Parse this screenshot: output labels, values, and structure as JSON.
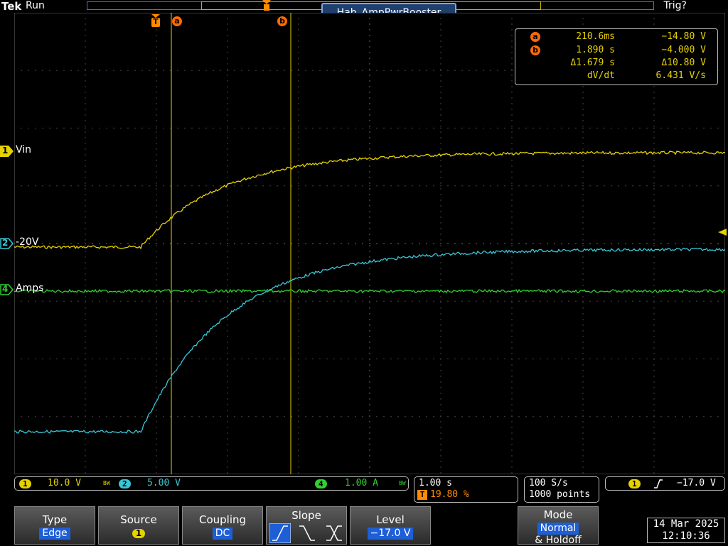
{
  "header": {
    "brand": "Tek",
    "run_state": "Run",
    "trigger_state": "Trig?",
    "title": "Hab_AmpPwrBooster"
  },
  "markers": {
    "trigger": "T",
    "cursor_a": "a",
    "cursor_b": "b"
  },
  "measurements": {
    "a": {
      "badge": "a",
      "time": "210.6ms",
      "volt": "−14.80 V"
    },
    "b": {
      "badge": "b",
      "time": "1.890 s",
      "volt": "−4.000 V"
    },
    "delta": {
      "time": "Δ1.679 s",
      "volt": "Δ10.80 V"
    },
    "dvdt": {
      "label": "dV/dt",
      "value": "6.431 V/s"
    }
  },
  "channels": {
    "ch1": {
      "num": "1",
      "label": "Vin",
      "scale": "10.0 V",
      "color": "#e6d200"
    },
    "ch2": {
      "num": "2",
      "label": "-20V",
      "scale": "5.00 V",
      "color": "#39c6d6"
    },
    "ch4": {
      "num": "4",
      "label": "Amps",
      "scale": "1.00 A",
      "color": "#2fd12f"
    }
  },
  "status": {
    "bw": "BW",
    "timebase": "1.00 s",
    "trigger_pos": "19.80 %",
    "sample_rate": "100 S/s",
    "record": "1000 points",
    "trig_src": "1",
    "trig_level": "−17.0 V"
  },
  "menu": {
    "type": {
      "label": "Type",
      "value": "Edge"
    },
    "source": {
      "label": "Source",
      "value": "1"
    },
    "coupling": {
      "label": "Coupling",
      "value": "DC"
    },
    "slope": {
      "label": "Slope"
    },
    "level": {
      "label": "Level",
      "value": "−17.0 V"
    },
    "mode": {
      "label": "Mode",
      "value": "Normal",
      "value2": "& Holdoff"
    }
  },
  "clock": {
    "date": "14 Mar 2025",
    "time": "12:10:36"
  }
}
